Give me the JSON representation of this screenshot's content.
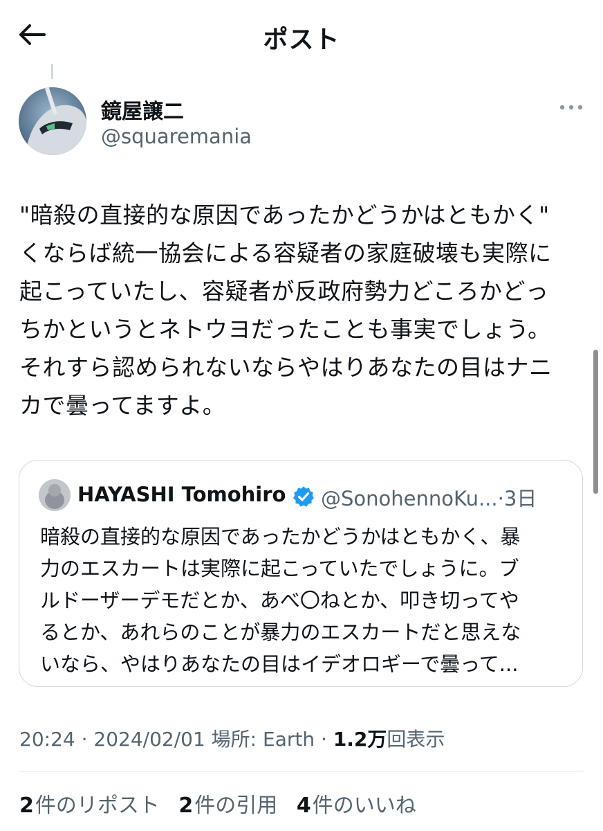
{
  "header": {
    "title": "ポスト",
    "back_icon": "arrow-left-icon"
  },
  "author": {
    "name": "鏡屋譲二",
    "handle": "@squaremania"
  },
  "tweet": {
    "lines": [
      "\"暗殺の直接的な原因であったかどうかはともかく\"",
      "くならば統一協会による容疑者の家庭破壊も実際に",
      "起こっていたし、容疑者が反政府勢力どころかどっ",
      "ちかというとネトウヨだったことも事実でしょう。",
      "それすら認められないならやはりあなたの目はナニ",
      "カで曇ってますよ。"
    ]
  },
  "quote": {
    "name": "HAYASHI Tomohiro",
    "handle_time": "@SonohennoKu...·3日",
    "verified_color": "#1d9bf0",
    "lines": [
      "暗殺の直接的な原因であったかどうかはともかく、暴",
      "力のエスカートは実際に起こっていたでしょうに。ブ",
      "ルドーザーデモだとか、あべ〇ねとか、叩き切ってや",
      "るとか、あれらのことが暴力のエスカートだと思えな",
      "いなら、やはりあなたの目はイデオロギーで曇って..."
    ]
  },
  "meta": {
    "time_date_place": "20:24 · 2024/02/01 場所: Earth · ",
    "views_count": "1.2万",
    "views_label": "回表示"
  },
  "stats": {
    "reposts_count": "2",
    "reposts_label": "件のリポスト",
    "quotes_count": "2",
    "quotes_label": "件の引用",
    "likes_count": "4",
    "likes_label": "件のいいね"
  }
}
